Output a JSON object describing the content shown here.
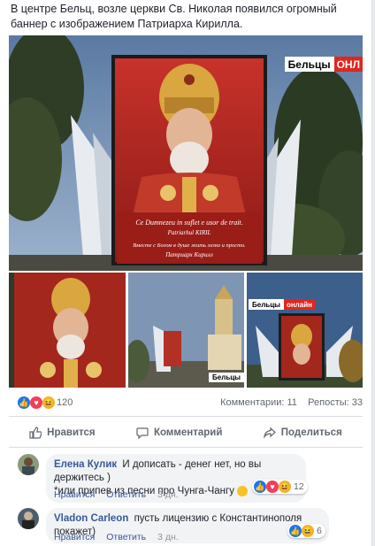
{
  "post": {
    "caption": "В центре Бельц, возле церкви Св. Николая появился огромный баннер с изображением Патриарха Кирилла."
  },
  "banner": {
    "line1": "Ce Dumnezeu in suflet e usor de trait.",
    "line2": "Patriarhul KIRIL",
    "line3": "Вместе с Богом в душе жить легко и просто.",
    "line4": "Патриарх Кирилл"
  },
  "watermark": {
    "main_text": "Бельцы",
    "main_red": "ОНЛ",
    "thumb2_text": "Бельцы",
    "thumb2_red": "онлайн",
    "thumb1_text": "Бельцы"
  },
  "stats": {
    "reactions_count": "120",
    "comments": "Комментарии: 11",
    "shares": "Репосты: 33"
  },
  "actions": {
    "like": "Нравится",
    "comment": "Комментарий",
    "share": "Поделиться"
  },
  "comments": [
    {
      "author": "Елена Кулик",
      "text_line1": "И дописать - денег нет, но вы держитесь )",
      "text_line2": "*или припев из песни про Чунга-Чангу",
      "like": "Нравится",
      "reply": "Ответить",
      "time": "3 дн.",
      "reactions": "12"
    },
    {
      "author": "Vladon Carleon",
      "text_line1": "пусть лицензию с Константинополя покажет)",
      "like": "Нравится",
      "reply": "Ответить",
      "time": "3 дн.",
      "reactions": "6"
    }
  ],
  "colors": {
    "link": "#385898",
    "accent_red": "#e0261e",
    "like_blue": "#1877f2"
  }
}
